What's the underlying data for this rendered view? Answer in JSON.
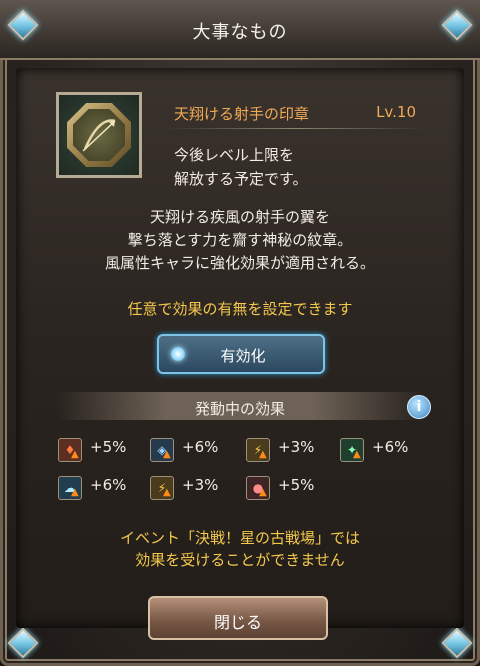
{
  "window": {
    "title": "大事なもの"
  },
  "item": {
    "name": "天翔ける射手の印章",
    "level": "Lv.10",
    "level_note": "今後レベル上限を\n解放する予定です。",
    "description": "天翔ける疾風の射手の翼を\n撃ち落とす力を齎す神秘の紋章。\n風属性キャラに強化効果が適用される。"
  },
  "setting": {
    "optional_text": "任意で効果の有無を設定できます",
    "toggle_label": "有効化"
  },
  "effects": {
    "header": "発動中の効果",
    "items": [
      {
        "icon": "fire-boost-icon",
        "value": "+5%"
      },
      {
        "icon": "shield-boost-icon",
        "value": "+6%"
      },
      {
        "icon": "double-strike-icon",
        "value": "+3%"
      },
      {
        "icon": "heal-sparkle-icon",
        "value": "+6%"
      },
      {
        "icon": "wind-spirit-icon",
        "value": "+6%"
      },
      {
        "icon": "triple-strike-icon",
        "value": "+3%"
      },
      {
        "icon": "dark-orb-icon",
        "value": "+5%"
      }
    ]
  },
  "notice": "イベント「決戦！星の古戦場」では\n効果を受けることができません",
  "buttons": {
    "close": "閉じる"
  },
  "colors": {
    "accent_orange": "#f0a955",
    "accent_yellow": "#f3c84c",
    "toggle_blue": "#7ec3e6"
  }
}
